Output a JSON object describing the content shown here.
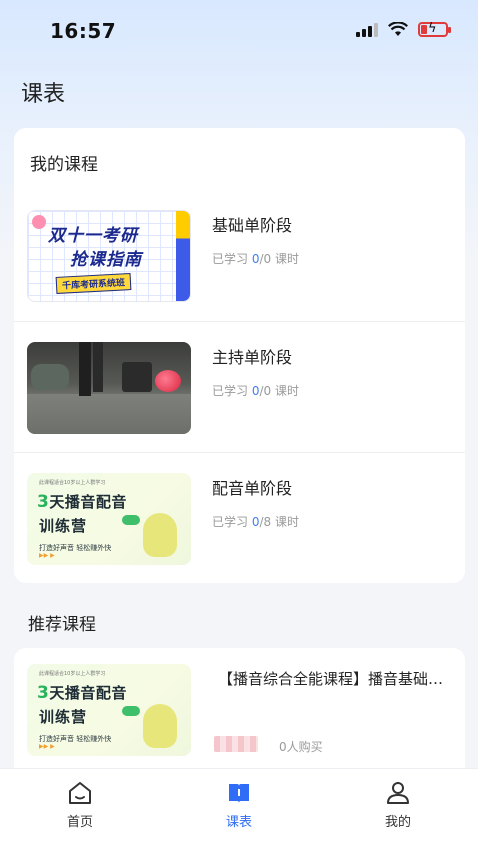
{
  "status_bar": {
    "time": "16:57"
  },
  "page": {
    "title": "课表"
  },
  "my_courses": {
    "title": "我的课程",
    "items": [
      {
        "name": "基础单阶段",
        "progress_prefix": "已学习 ",
        "learned": "0",
        "total": "/0",
        "unit": " 课时",
        "thumb": {
          "line1": "双十一考研",
          "line2": "抢课指南",
          "tag": "千库考研系统班"
        }
      },
      {
        "name": "主持单阶段",
        "progress_prefix": "已学习 ",
        "learned": "0",
        "total": "/0",
        "unit": " 课时"
      },
      {
        "name": "配音单阶段",
        "progress_prefix": "已学习 ",
        "learned": "0",
        "total": "/8",
        "unit": " 课时",
        "thumb": {
          "small": "此课程适合10岁以上人群学习",
          "num": "3",
          "line1": "天播音配音",
          "line2": "训练营",
          "sub": "打造好声音 轻松赚外快"
        }
      }
    ]
  },
  "recommended": {
    "title": "推荐课程",
    "items": [
      {
        "name": "【播音综合全能课程】播音基础课程",
        "buyers": "0人购买",
        "thumb": {
          "small": "此课程适合10岁以上人群学习",
          "num": "3",
          "line1": "天播音配音",
          "line2": "训练营",
          "sub": "打造好声音 轻松赚外快"
        }
      }
    ]
  },
  "tabbar": {
    "tabs": [
      {
        "label": "首页",
        "icon": "home-icon",
        "active": false
      },
      {
        "label": "课表",
        "icon": "book-icon",
        "active": true
      },
      {
        "label": "我的",
        "icon": "user-icon",
        "active": false
      }
    ]
  },
  "colors": {
    "accent": "#2f6df6",
    "progress_num": "#3f7ef5",
    "muted": "#9a9a9a"
  }
}
